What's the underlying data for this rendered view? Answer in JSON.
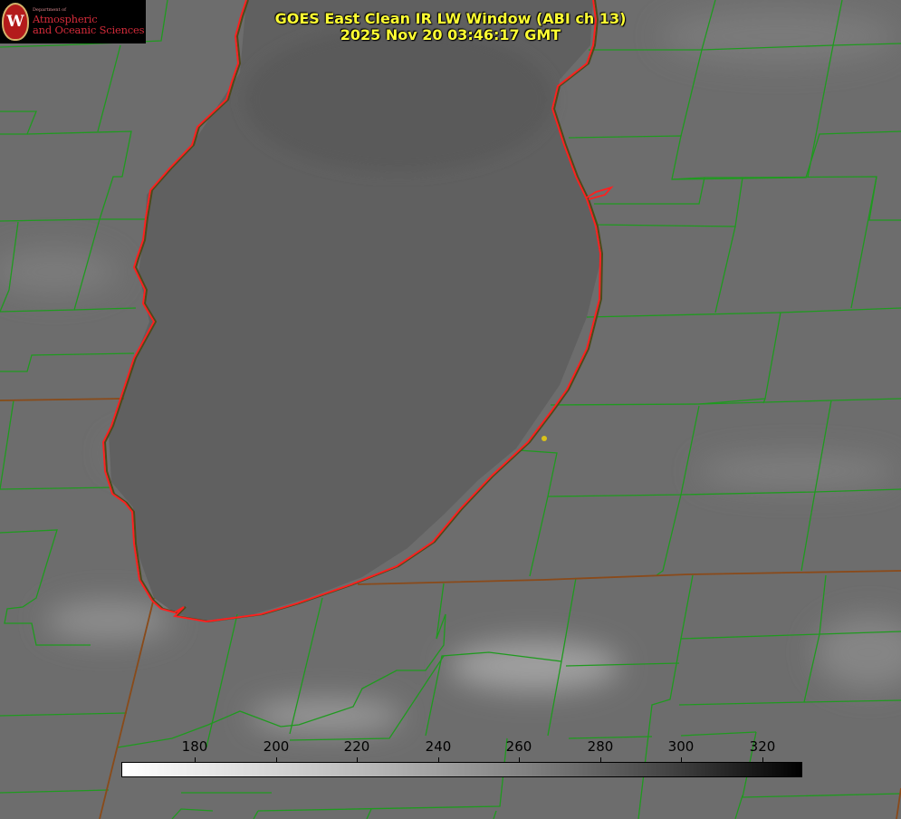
{
  "title": {
    "line1": "GOES East Clean IR LW Window (ABI ch 13)",
    "line2": "2025 Nov 20 03:46:17 GMT"
  },
  "logo": {
    "department": "Department of",
    "line1": "Atmospheric",
    "line2": "and Oceanic Sciences",
    "crest_letter": "W"
  },
  "colorbar": {
    "ticks": [
      "180",
      "200",
      "220",
      "240",
      "260",
      "280",
      "300",
      "320"
    ],
    "colormap": "grayscale, white (cold) to black (warm)"
  },
  "colors": {
    "title": "#ffff33",
    "county_lines": "#1f9a1f",
    "state_lines": "#8a4a1a",
    "shoreline": "#ff2020",
    "station_dot": "#d9c21a",
    "background": "#6d6d6d"
  }
}
